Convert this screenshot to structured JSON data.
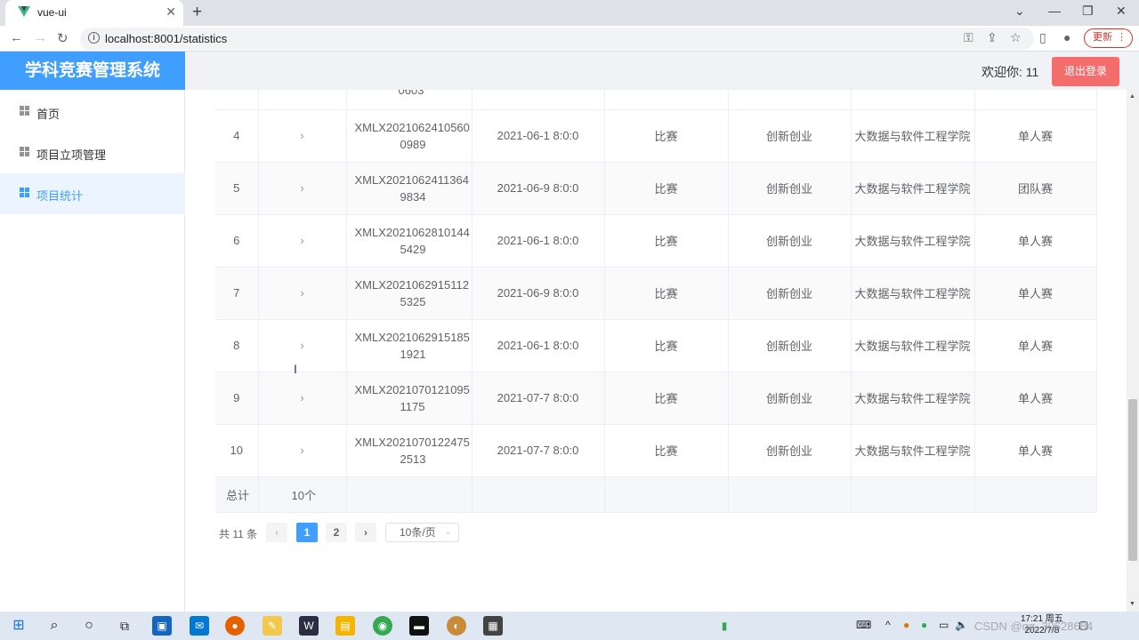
{
  "browser": {
    "tab_title": "vue-ui",
    "url": "localhost:8001/statistics",
    "update_label": "更新"
  },
  "app": {
    "title": "学科竞赛管理系统",
    "welcome": "欢迎你: 11",
    "logout_label": "退出登录"
  },
  "sidebar": {
    "items": [
      {
        "label": "首页"
      },
      {
        "label": "项目立项管理"
      },
      {
        "label": "项目统计"
      }
    ]
  },
  "table": {
    "partial_code_tail": "0603",
    "rows": [
      {
        "index": "4",
        "code_line1": "XMLX2021062410560",
        "code_line2": "0989",
        "date": "2021-06-1 8:0:0",
        "type": "比赛",
        "category": "创新创业",
        "college": "大数据与软件工程学院",
        "mode": "单人赛"
      },
      {
        "index": "5",
        "code_line1": "XMLX2021062411364",
        "code_line2": "9834",
        "date": "2021-06-9 8:0:0",
        "type": "比赛",
        "category": "创新创业",
        "college": "大数据与软件工程学院",
        "mode": "团队赛"
      },
      {
        "index": "6",
        "code_line1": "XMLX2021062810144",
        "code_line2": "5429",
        "date": "2021-06-1 8:0:0",
        "type": "比赛",
        "category": "创新创业",
        "college": "大数据与软件工程学院",
        "mode": "单人赛"
      },
      {
        "index": "7",
        "code_line1": "XMLX2021062915112",
        "code_line2": "5325",
        "date": "2021-06-9 8:0:0",
        "type": "比赛",
        "category": "创新创业",
        "college": "大数据与软件工程学院",
        "mode": "单人赛"
      },
      {
        "index": "8",
        "code_line1": "XMLX2021062915185",
        "code_line2": "1921",
        "date": "2021-06-1 8:0:0",
        "type": "比赛",
        "category": "创新创业",
        "college": "大数据与软件工程学院",
        "mode": "单人赛"
      },
      {
        "index": "9",
        "code_line1": "XMLX2021070121095",
        "code_line2": "1175",
        "date": "2021-07-7 8:0:0",
        "type": "比赛",
        "category": "创新创业",
        "college": "大数据与软件工程学院",
        "mode": "单人赛"
      },
      {
        "index": "10",
        "code_line1": "XMLX2021070122475",
        "code_line2": "2513",
        "date": "2021-07-7 8:0:0",
        "type": "比赛",
        "category": "创新创业",
        "college": "大数据与软件工程学院",
        "mode": "单人赛"
      }
    ],
    "footer": {
      "label": "总计",
      "value": "10个"
    }
  },
  "pagination": {
    "total": "共 11 条",
    "pages": [
      "1",
      "2"
    ],
    "current": "1",
    "page_size": "10条/页"
  },
  "taskbar": {
    "time": "17:21 周五",
    "date": "2022/7/8"
  },
  "watermark": "CSDN @qq_30628684",
  "colors": {
    "primary": "#409eff",
    "danger": "#f56c6c",
    "header_bg": "#f0f2f5"
  }
}
